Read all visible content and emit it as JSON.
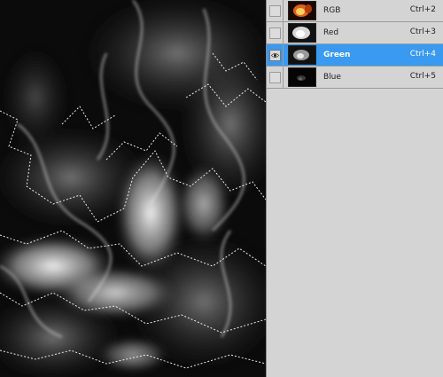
{
  "canvas": {
    "description_icon": "flame-grayscale-selection"
  },
  "channels": [
    {
      "name": "RGB",
      "shortcut": "Ctrl+2",
      "visible": false,
      "selected": false,
      "thumb": "rgb"
    },
    {
      "name": "Red",
      "shortcut": "Ctrl+3",
      "visible": false,
      "selected": false,
      "thumb": "red"
    },
    {
      "name": "Green",
      "shortcut": "Ctrl+4",
      "visible": true,
      "selected": true,
      "thumb": "green"
    },
    {
      "name": "Blue",
      "shortcut": "Ctrl+5",
      "visible": false,
      "selected": false,
      "thumb": "blue"
    }
  ],
  "colors": {
    "selected_row": "#3a99f0",
    "panel_bg": "#d4d4d4",
    "canvas_bg": "#0a0a0a"
  }
}
